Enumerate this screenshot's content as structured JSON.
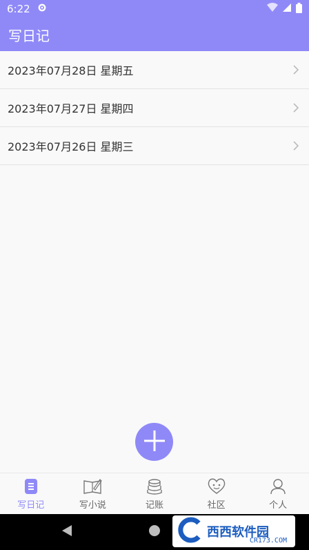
{
  "status_bar": {
    "time": "6:22"
  },
  "app_bar": {
    "title": "写日记"
  },
  "diary_list": [
    {
      "label": "2023年07月28日 星期五"
    },
    {
      "label": "2023年07月27日 星期四"
    },
    {
      "label": "2023年07月26日 星期三"
    }
  ],
  "tabs": [
    {
      "label": "写日记",
      "icon": "diary-icon"
    },
    {
      "label": "写小说",
      "icon": "novel-icon"
    },
    {
      "label": "记账",
      "icon": "accounting-icon"
    },
    {
      "label": "社区",
      "icon": "community-icon"
    },
    {
      "label": "个人",
      "icon": "profile-icon"
    }
  ],
  "watermark": {
    "text": "西西软件园",
    "sub": "CR173.COM"
  },
  "colors": {
    "accent": "#8f89f8",
    "text": "#333333",
    "tab_inactive": "#666666"
  }
}
